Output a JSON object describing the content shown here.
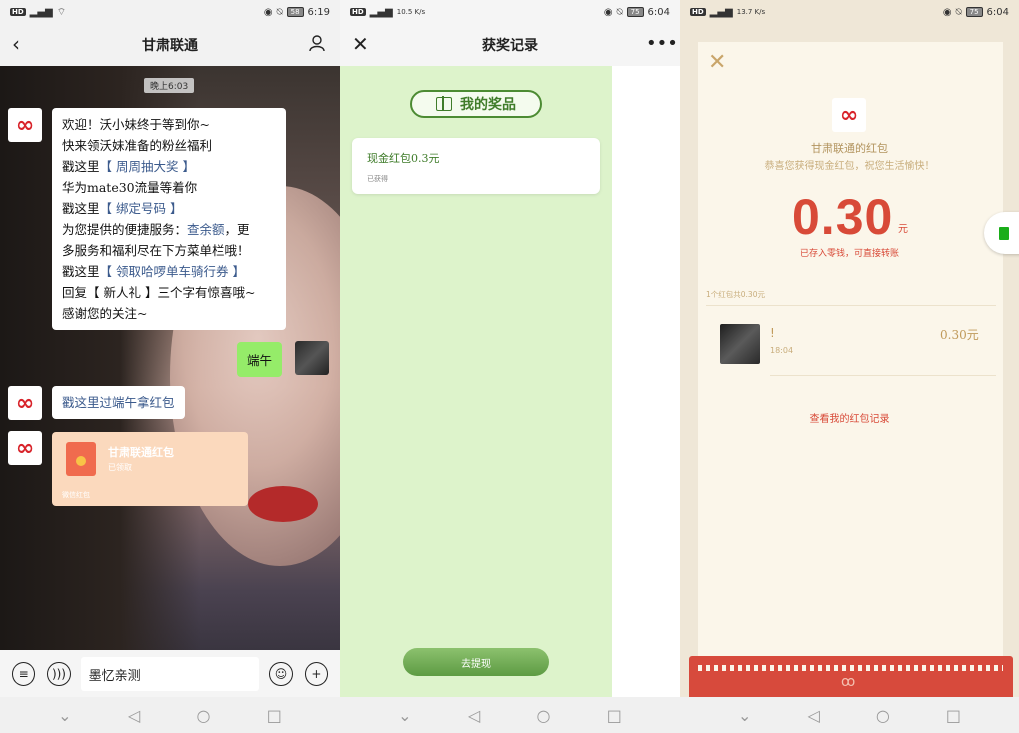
{
  "panel1": {
    "status": {
      "hd": "HD",
      "speed": "",
      "time": "6:19",
      "battery": "58"
    },
    "title": "甘肃联通",
    "time_chip": "晚上6:03",
    "message_lines": [
      {
        "text": "欢迎！沃小妹终于等到你~"
      },
      {
        "text": "快来领沃妹准备的粉丝福利"
      },
      {
        "pre": "戳这里",
        "link": "【 周周抽大奖 】",
        "post": ""
      },
      {
        "text": "华为mate30流量等着你"
      },
      {
        "pre": "戳这里",
        "link": "【 绑定号码 】",
        "post": ""
      },
      {
        "pre": "为您提供的便捷服务：",
        "link": "查余额",
        "post": "，更"
      },
      {
        "text": "多服务和福利尽在下方菜单栏哦！"
      },
      {
        "pre": "戳这里",
        "link": "【 领取哈啰单车骑行券 】",
        "post": ""
      },
      {
        "text": "回复【 新人礼 】三个字有惊喜哦~"
      },
      {
        "text": "感谢您的关注~"
      }
    ],
    "user_msg": "端午",
    "link_msg": "戳这里过端午拿红包",
    "redpacket": {
      "title": "甘肃联通红包",
      "status": "已领取",
      "foot": "微信红包"
    },
    "input_value": "墨忆亲测"
  },
  "panel2": {
    "status": {
      "hd": "HD",
      "speed": "10.5 K/s",
      "time": "6:04",
      "battery": "75"
    },
    "title": "获奖记录",
    "section_title": "我的奖品",
    "prize_name": "现金红包0.3元",
    "prize_status": "已获得",
    "withdraw_label": "去提现"
  },
  "panel3": {
    "status": {
      "hd": "HD",
      "speed": "13.7 K/s",
      "time": "6:04",
      "battery": "75"
    },
    "sender": "甘肃联通的红包",
    "wish": "恭喜您获得现金红包，祝您生活愉快！",
    "amount": "0.30",
    "unit": "元",
    "stored": "已存入零钱，可直接转账",
    "count_line": "1个红包共0.30元",
    "receiver_name": "!",
    "receiver_time": "18:04",
    "receiver_amount": "0.30元",
    "records_link": "查看我的红包记录"
  },
  "icons": {
    "close": "close-icon",
    "more": "more-icon",
    "back": "back-icon",
    "profile": "profile-icon"
  },
  "colors": {
    "unicom_red": "#d8232a",
    "wechat_green": "#95ec69",
    "prize_green": "#3f7c2a",
    "packet_red": "#d84a38"
  }
}
